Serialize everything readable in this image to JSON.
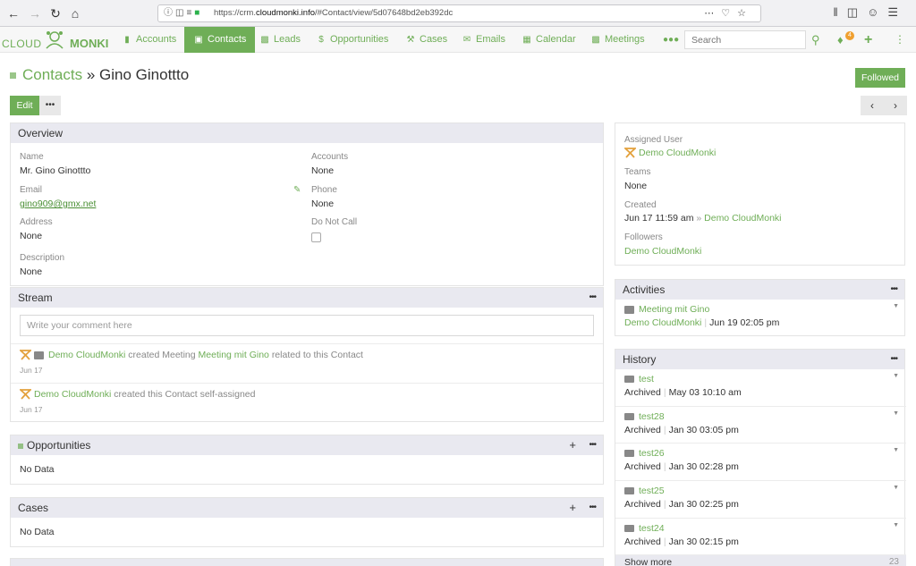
{
  "browser": {
    "url_prefix": "https://crm.",
    "url_domain": "cloudmonki.info",
    "url_path": "/#Contact/view/5d07648bd2eb392dc"
  },
  "app": {
    "logo_cloud": "CLOUD",
    "logo_monki": "MONKI",
    "nav": [
      {
        "label": "Accounts",
        "icon": "book-icon"
      },
      {
        "label": "Contacts",
        "icon": "contact-card-icon"
      },
      {
        "label": "Leads",
        "icon": "id-card-icon"
      },
      {
        "label": "Opportunities",
        "icon": "dollar-icon"
      },
      {
        "label": "Cases",
        "icon": "wrench-icon"
      },
      {
        "label": "Emails",
        "icon": "envelope-icon"
      },
      {
        "label": "Calendar",
        "icon": "calendar-icon"
      },
      {
        "label": "Meetings",
        "icon": "briefcase-icon"
      }
    ],
    "search_placeholder": "Search",
    "notification_count": "4"
  },
  "header": {
    "breadcrumb_root": "Contacts",
    "breadcrumb_sep": "»",
    "record_name": "Gino Ginottto",
    "followed_label": "Followed",
    "edit_label": "Edit"
  },
  "overview": {
    "title": "Overview",
    "name_label": "Name",
    "name_value": "Mr. Gino Ginottto",
    "accounts_label": "Accounts",
    "accounts_value": "None",
    "email_label": "Email",
    "email_value": "gino909@gmx.net",
    "phone_label": "Phone",
    "phone_value": "None",
    "address_label": "Address",
    "address_value": "None",
    "donotcall_label": "Do Not Call",
    "description_label": "Description",
    "description_value": "None"
  },
  "stream": {
    "title": "Stream",
    "placeholder": "Write your comment here",
    "entries": [
      {
        "user": "Demo CloudMonki",
        "action": "created Meeting",
        "target": "Meeting mit Gino",
        "suffix": "related to this Contact",
        "date": "Jun 17"
      },
      {
        "user": "Demo CloudMonki",
        "action": "created this Contact self-assigned",
        "date": "Jun 17"
      }
    ]
  },
  "opportunities": {
    "title": "Opportunities",
    "empty": "No Data"
  },
  "cases": {
    "title": "Cases",
    "empty": "No Data"
  },
  "side": {
    "assigned_label": "Assigned User",
    "assigned_value": "Demo CloudMonki",
    "teams_label": "Teams",
    "teams_value": "None",
    "created_label": "Created",
    "created_date": "Jun 17 11:59 am",
    "created_sep": "»",
    "created_by": "Demo CloudMonki",
    "followers_label": "Followers",
    "followers_value": "Demo CloudMonki"
  },
  "activities": {
    "title": "Activities",
    "items": [
      {
        "name": "Meeting mit Gino",
        "user": "Demo CloudMonki",
        "date": "Jun 19 02:05 pm"
      }
    ]
  },
  "history": {
    "title": "History",
    "items": [
      {
        "name": "test",
        "status": "Archived",
        "date": "May 03 10:10 am"
      },
      {
        "name": "test28",
        "status": "Archived",
        "date": "Jan 30 03:05 pm"
      },
      {
        "name": "test26",
        "status": "Archived",
        "date": "Jan 30 02:28 pm"
      },
      {
        "name": "test25",
        "status": "Archived",
        "date": "Jan 30 02:25 pm"
      },
      {
        "name": "test24",
        "status": "Archived",
        "date": "Jan 30 02:15 pm"
      }
    ],
    "show_more": "Show more",
    "total": "23"
  },
  "colors": {
    "accent": "#6fae57",
    "panel_header": "#e9e9f0"
  }
}
